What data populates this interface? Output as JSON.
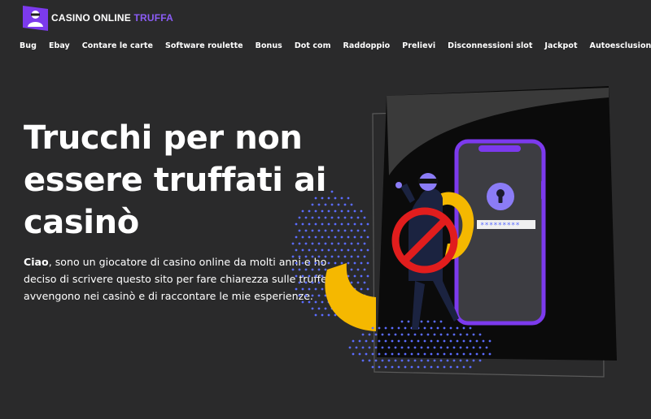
{
  "site": {
    "logo_text": "CASINO ONLINE",
    "logo_accent": "TRUFFA"
  },
  "nav": {
    "items": [
      {
        "label": "Bug",
        "name": "nav-item-bug"
      },
      {
        "label": "Ebay",
        "name": "nav-item-ebay"
      },
      {
        "label": "Contare le carte",
        "name": "nav-item-contare-le-carte"
      },
      {
        "label": "Software roulette",
        "name": "nav-item-software-roulette"
      },
      {
        "label": "Bonus",
        "name": "nav-item-bonus"
      },
      {
        "label": "Dot com",
        "name": "nav-item-dot-com"
      },
      {
        "label": "Raddoppio",
        "name": "nav-item-raddoppio"
      },
      {
        "label": "Prelievi",
        "name": "nav-item-prelievi"
      },
      {
        "label": "Disconnessioni slot",
        "name": "nav-item-disconnessioni-slot"
      },
      {
        "label": "Jackpot",
        "name": "nav-item-jackpot"
      },
      {
        "label": "Autoesclusione",
        "name": "nav-item-autoesclusione"
      }
    ],
    "search_icon": "search-icon"
  },
  "hero": {
    "title_line1": "Trucchi per non",
    "title_line2": "essere truffati ai",
    "title_line3": "casinò",
    "intro_bold": "Ciao",
    "intro_rest": ", sono un giocatore di casino online da molti anni e ho deciso di scrivere questo sito per fare chiarezza sulle truffe che avvengono nei casinò e di raccontare le mie esperienze.",
    "illustration_password_mask": "*********"
  },
  "colors": {
    "background": "#2a2a2b",
    "accent": "#8b5cf6",
    "phone_frame": "#7c3aed",
    "prohibition_red": "#e11d1d",
    "yellow": "#f5b800",
    "dots": "#5b6cff"
  }
}
